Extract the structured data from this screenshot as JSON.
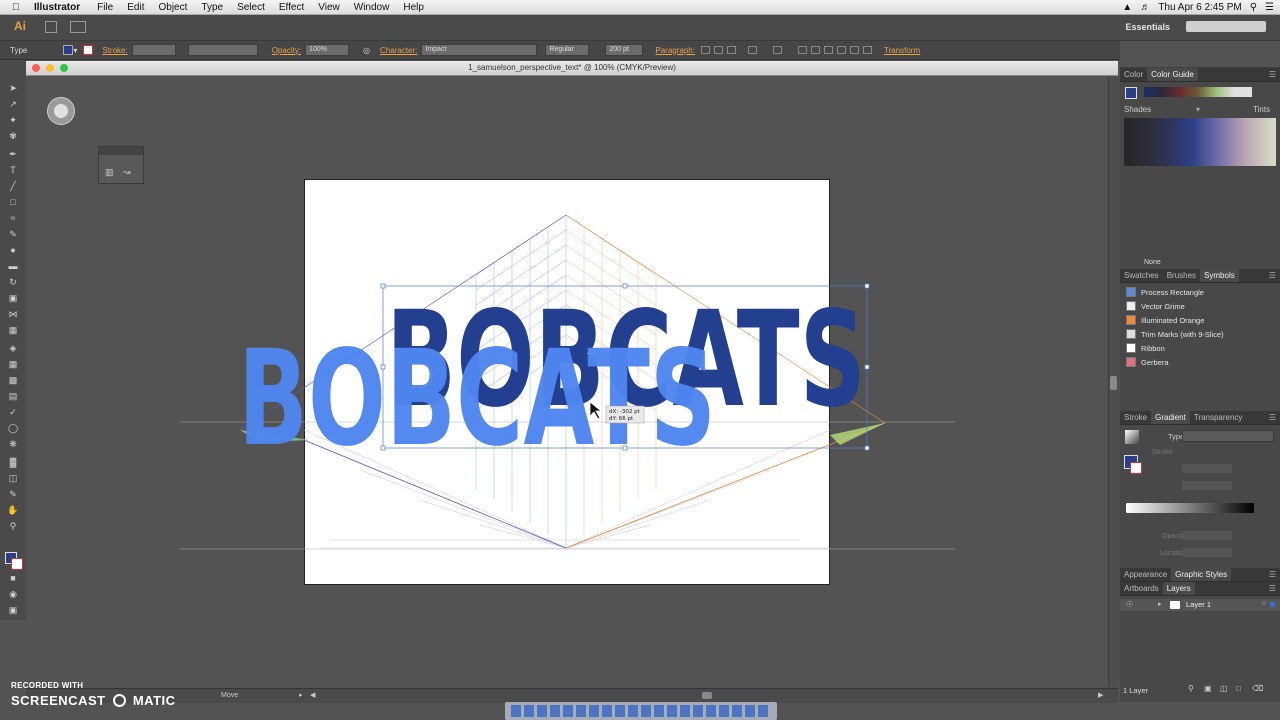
{
  "menubar": {
    "app_name": "Illustrator",
    "items": [
      "File",
      "Edit",
      "Object",
      "Type",
      "Select",
      "Effect",
      "View",
      "Window",
      "Help"
    ],
    "clock": "Thu Apr 6  2:45 PM",
    "icons": [
      "apple-icon",
      "wifi-icon",
      "volume-icon",
      "spotlight-icon",
      "notification-icon"
    ]
  },
  "appbar": {
    "logo": "Ai",
    "workspace": "Essentials"
  },
  "controlbar": {
    "tool_name": "Type",
    "stroke_label": "Stroke:",
    "opacity_label": "Opacity:",
    "opacity_value": "100%",
    "character_label": "Character:",
    "font_value": "Impact",
    "style_value": "Regular",
    "size_value": "200 pt",
    "paragraph_label": "Paragraph:",
    "transform_label": "Transform"
  },
  "document": {
    "title": "1_samuelson_perspective_text* @ 100% (CMYK/Preview)"
  },
  "artwork": {
    "text_back": "BOBCATS",
    "text_front": "BOBCATS",
    "back_color": "#233f8f",
    "front_color": "#4f86f0",
    "tooltip_dx": "dX: -302 pt",
    "tooltip_dy": "dY: 66 pt"
  },
  "panels": {
    "color_tabs": [
      "Color",
      "Color Guide"
    ],
    "shades_label": "Shades",
    "tints_label": "Tints",
    "none_label": "None",
    "symbol_tabs": [
      "Swatches",
      "Brushes",
      "Symbols"
    ],
    "symbols": [
      "Process Rectangle",
      "Vector Grime",
      "Illuminated Orange",
      "Trim Marks (with 9-Slice)",
      "Ribbon",
      "Gerbera"
    ],
    "gradient_tabs": [
      "Stroke",
      "Gradient",
      "Transparency"
    ],
    "gradient_type_label": "Type:",
    "gradient_stroke_label": "Stroke:",
    "gradient_opacity_label": "Opacity:",
    "gradient_location_label": "Location:",
    "appearance_tabs": [
      "Appearance",
      "Graphic Styles"
    ],
    "layers_tabs": [
      "Artboards",
      "Layers"
    ],
    "layer_name": "Layer 1",
    "layers_count": "1 Layer"
  },
  "statusbar": {
    "mode": "Move"
  },
  "watermark": {
    "line1": "RECORDED WITH",
    "line2": "SCREENCAST",
    "line3": "MATIC"
  }
}
